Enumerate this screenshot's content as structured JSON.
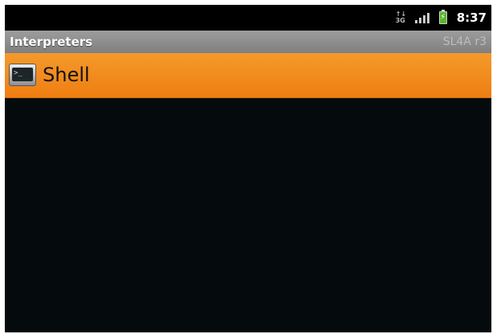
{
  "status_bar": {
    "network_label": "3G",
    "icons": [
      "3g-icon",
      "signal-icon",
      "battery-charging-icon"
    ],
    "time": "8:37"
  },
  "title_bar": {
    "title": "Interpreters",
    "version": "SL4A r3"
  },
  "interpreters": [
    {
      "label": "Shell",
      "icon": "terminal-icon",
      "selected": true
    }
  ],
  "colors": {
    "selection": "#ef8a1a",
    "background": "#050b0c",
    "title_bar": "#8c8c8c"
  }
}
